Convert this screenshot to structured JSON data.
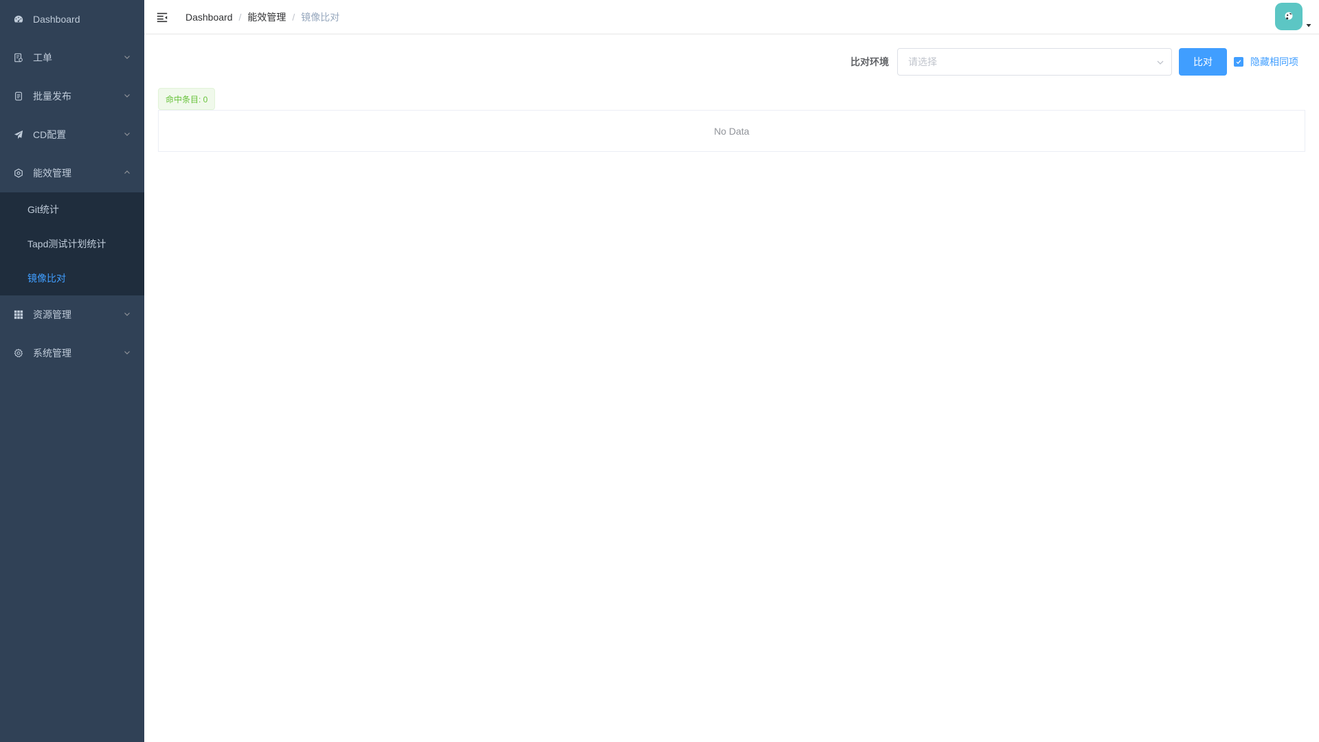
{
  "sidebar": {
    "items": [
      {
        "label": "Dashboard",
        "icon": "dashboard-icon"
      },
      {
        "label": "工单",
        "icon": "ticket-icon"
      },
      {
        "label": "批量发布",
        "icon": "batch-release-icon"
      },
      {
        "label": "CD配置",
        "icon": "paper-plane-icon"
      },
      {
        "label": "能效管理",
        "icon": "efficiency-icon"
      },
      {
        "label": "资源管理",
        "icon": "grid-icon"
      },
      {
        "label": "系统管理",
        "icon": "gear-icon"
      }
    ],
    "submenu": {
      "items": [
        {
          "label": "Git统计"
        },
        {
          "label": "Tapd测试计划统计"
        },
        {
          "label": "镜像比对"
        }
      ]
    }
  },
  "header": {
    "breadcrumb": [
      "Dashboard",
      "能效管理",
      "镜像比对"
    ]
  },
  "filters": {
    "env_label": "比对环境",
    "env_placeholder": "请选择",
    "compare_button": "比对",
    "hide_same_label": "隐藏相同项",
    "hide_same_checked": true
  },
  "results": {
    "hit_count_label": "命中条目: 0",
    "empty_text": "No Data"
  },
  "colors": {
    "sidebar_bg": "#304156",
    "submenu_bg": "#1f2d3d",
    "accent": "#409eff",
    "success": "#67c23a",
    "avatar_bg": "#5cc6c4"
  }
}
